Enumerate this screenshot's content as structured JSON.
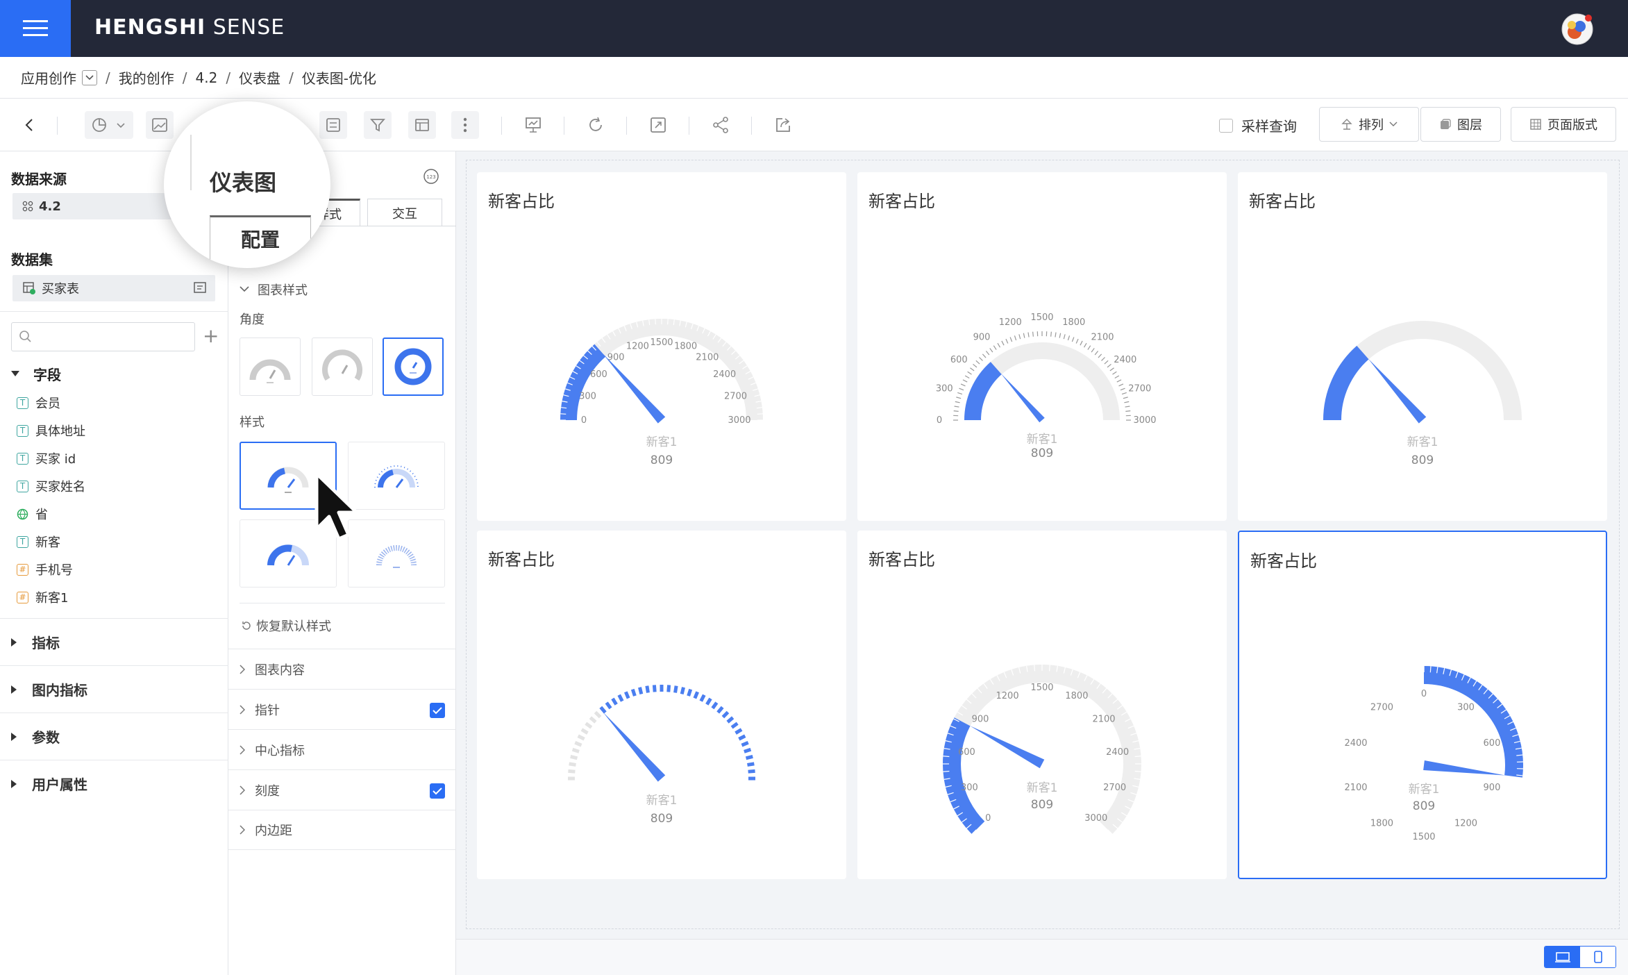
{
  "app": {
    "brand_bold": "HENGSHI",
    "brand_light": "SENSE"
  },
  "breadcrumb": {
    "root": "应用创作",
    "items": [
      "我的创作",
      "4.2",
      "仪表盘",
      "仪表图-优化"
    ],
    "sep": "/"
  },
  "toolbar": {
    "sample_query": "采样查询",
    "sort": "排列",
    "layers": "图层",
    "page_layout": "页面版式"
  },
  "left": {
    "datasource_title": "数据来源",
    "datasource_name": "4.2",
    "dataset_title": "数据集",
    "dataset_name": "买家表",
    "search_placeholder": "",
    "fields_title": "字段",
    "fields": [
      {
        "name": "会员",
        "type": "text"
      },
      {
        "name": "具体地址",
        "type": "text"
      },
      {
        "name": "买家 id",
        "type": "text"
      },
      {
        "name": "买家姓名",
        "type": "text"
      },
      {
        "name": "省",
        "type": "geo"
      },
      {
        "name": "新客",
        "type": "text"
      },
      {
        "name": "手机号",
        "type": "number"
      },
      {
        "name": "新客1",
        "type": "number"
      }
    ],
    "groups": [
      "指标",
      "图内指标",
      "参数",
      "用户属性"
    ]
  },
  "panel": {
    "tab_style": "样式",
    "tab_interact": "交互",
    "chart_style_title": "图表样式",
    "angle_label": "角度",
    "style_label": "样式",
    "reset_label": "恢复默认样式",
    "sections": [
      {
        "label": "图表内容",
        "checked": false
      },
      {
        "label": "指针",
        "checked": true
      },
      {
        "label": "中心指标",
        "checked": false
      },
      {
        "label": "刻度",
        "checked": true
      },
      {
        "label": "内边距",
        "checked": false
      }
    ]
  },
  "magnifier": {
    "title": "仪表图",
    "tab": "配置"
  },
  "gauges": {
    "value_text": "809",
    "metric_name": "新客1",
    "cards": [
      {
        "title": "新客占比",
        "ticks": [
          "0",
          "300",
          "600",
          "900",
          "1200",
          "1500",
          "1800",
          "2100",
          "2400",
          "2700",
          "3000"
        ]
      },
      {
        "title": "新客占比",
        "ticks": [
          "0",
          "300",
          "600",
          "900",
          "1200",
          "1500",
          "1800",
          "2100",
          "2400",
          "2700",
          "3000"
        ]
      },
      {
        "title": "新客占比"
      },
      {
        "title": "新客占比"
      },
      {
        "title": "新客占比",
        "ticks": [
          "0",
          "300",
          "600",
          "900",
          "1200",
          "1500",
          "1800",
          "2100",
          "2400",
          "2700",
          "3000"
        ]
      },
      {
        "title": "新客占比",
        "ticks": [
          "0",
          "300",
          "600",
          "900",
          "1200",
          "1500",
          "1800",
          "2100",
          "2400",
          "2700"
        ]
      }
    ]
  },
  "colors": {
    "accent": "#2a6df4",
    "gauge_fill": "#4a7ef0",
    "track": "#eeeeee",
    "topbar": "#232838"
  }
}
